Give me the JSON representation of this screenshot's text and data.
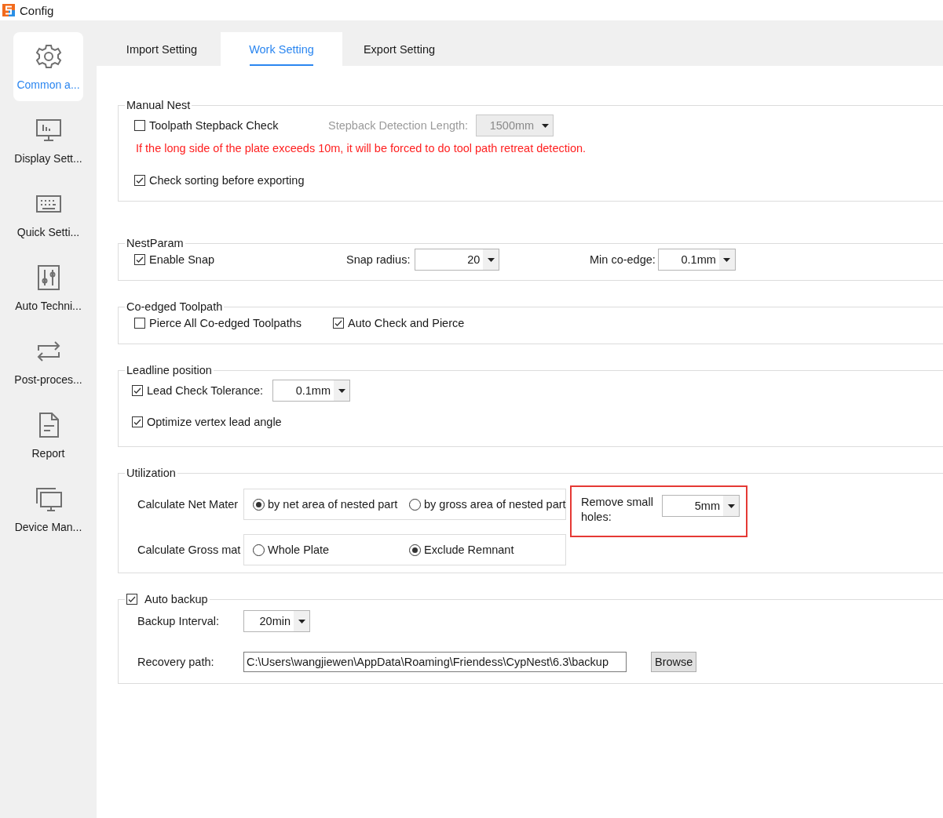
{
  "window": {
    "title": "Config"
  },
  "sidebar": {
    "items": [
      {
        "label": "Common a...",
        "selected": true
      },
      {
        "label": "Display Sett...",
        "selected": false
      },
      {
        "label": "Quick Setti...",
        "selected": false
      },
      {
        "label": "Auto Techni...",
        "selected": false
      },
      {
        "label": "Post-proces...",
        "selected": false
      },
      {
        "label": "Report",
        "selected": false
      },
      {
        "label": "Device Man...",
        "selected": false
      }
    ]
  },
  "tabs": [
    {
      "label": "Import Setting",
      "selected": false
    },
    {
      "label": "Work Setting",
      "selected": true
    },
    {
      "label": "Export Setting",
      "selected": false
    }
  ],
  "manual_nest": {
    "title": "Manual Nest",
    "stepback_check": {
      "label": "Toolpath Stepback Check",
      "checked": false
    },
    "detection_length": {
      "label": "Stepback Detection Length:",
      "value": "1500mm",
      "disabled": true
    },
    "warning": "If the long side of the plate exceeds 10m, it will be forced to do tool path retreat detection.",
    "check_sorting": {
      "label": "Check sorting before exporting",
      "checked": true
    }
  },
  "nest_param": {
    "title": "NestParam",
    "enable_snap": {
      "label": "Enable Snap",
      "checked": true
    },
    "snap_radius": {
      "label": "Snap radius:",
      "value": "20"
    },
    "min_co_edge": {
      "label": "Min co-edge:",
      "value": "0.1mm"
    }
  },
  "co_edged_toolpath": {
    "title": "Co-edged Toolpath",
    "options": [
      {
        "label": "Pierce All Co-edged Toolpaths",
        "checked": false
      },
      {
        "label": "Auto Check and Pierce",
        "checked": true
      }
    ]
  },
  "leadline_position": {
    "title": "Leadline position",
    "lead_check": {
      "label": "Lead Check Tolerance:",
      "checked": true,
      "value": "0.1mm"
    },
    "optimize_vertex": {
      "label": "Optimize vertex lead angle",
      "checked": true
    }
  },
  "utilization": {
    "title": "Utilization",
    "net_material": {
      "label": "Calculate Net Mater",
      "options": [
        {
          "label": "by net area of nested part",
          "selected": true
        },
        {
          "label": "by gross area of nested part",
          "selected": false
        }
      ]
    },
    "gross_material": {
      "label": "Calculate Gross mat",
      "options": [
        {
          "label": "Whole Plate",
          "selected": false
        },
        {
          "label": "Exclude Remnant",
          "selected": true
        }
      ]
    },
    "remove_small_holes": {
      "label": "Remove small holes:",
      "value": "5mm",
      "highlighted": true
    }
  },
  "auto_backup": {
    "title": "Auto backup",
    "checked": true,
    "interval": {
      "label": "Backup Interval:",
      "value": "20min"
    },
    "recovery_path": {
      "label": "Recovery path:",
      "value": "C:\\Users\\wangjiewen\\AppData\\Roaming\\Friendess\\CypNest\\6.3\\backup"
    },
    "browse": "Browse"
  }
}
